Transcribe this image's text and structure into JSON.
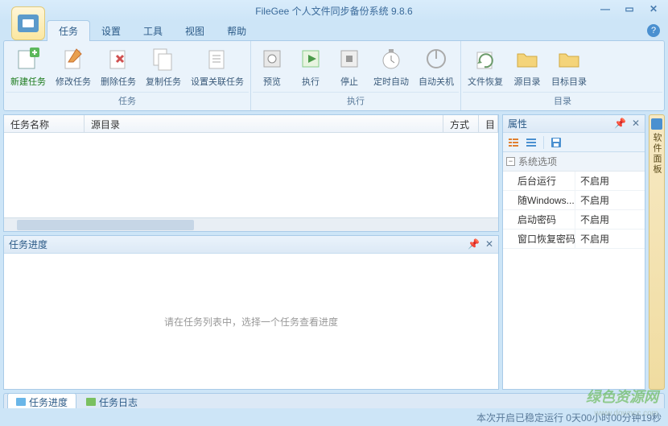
{
  "title": "FileGee 个人文件同步备份系统 9.8.6",
  "menu": {
    "items": [
      "任务",
      "设置",
      "工具",
      "视图",
      "帮助"
    ],
    "active": 0
  },
  "ribbon": {
    "groups": [
      {
        "name": "任务",
        "buttons": [
          {
            "label": "新建任务",
            "icon": "new",
            "highlight": true
          },
          {
            "label": "修改任务",
            "icon": "edit"
          },
          {
            "label": "删除任务",
            "icon": "delete"
          },
          {
            "label": "复制任务",
            "icon": "copy"
          },
          {
            "label": "设置关联任务",
            "icon": "link"
          }
        ]
      },
      {
        "name": "执行",
        "buttons": [
          {
            "label": "预览",
            "icon": "preview"
          },
          {
            "label": "执行",
            "icon": "run"
          },
          {
            "label": "停止",
            "icon": "stop"
          },
          {
            "label": "定时自动",
            "icon": "timer"
          },
          {
            "label": "自动关机",
            "icon": "shutdown"
          }
        ]
      },
      {
        "name": "目录",
        "buttons": [
          {
            "label": "文件恢复",
            "icon": "restore"
          },
          {
            "label": "源目录",
            "icon": "folder-src"
          },
          {
            "label": "目标目录",
            "icon": "folder-dst"
          }
        ]
      }
    ]
  },
  "task_grid": {
    "columns": [
      "任务名称",
      "源目录",
      "方式",
      "目标"
    ]
  },
  "progress_panel": {
    "title": "任务进度",
    "empty_text": "请在任务列表中，选择一个任务查看进度"
  },
  "props_panel": {
    "title": "属性",
    "category": "系统选项",
    "rows": [
      {
        "key": "后台运行",
        "val": "不启用"
      },
      {
        "key": "随Windows...",
        "val": "不启用"
      },
      {
        "key": "启动密码",
        "val": "不启用"
      },
      {
        "key": "窗口恢复密码",
        "val": "不启用"
      }
    ]
  },
  "side_tab": "软件面板",
  "bottom_tabs": [
    {
      "label": "任务进度",
      "color": "#6ab6e8"
    },
    {
      "label": "任务日志",
      "color": "#7ac060"
    }
  ],
  "status": "本次开启已稳定运行 0天00小时00分钟19秒",
  "watermark": "绿色资源网",
  "watermark_url": "www.downcc.com"
}
